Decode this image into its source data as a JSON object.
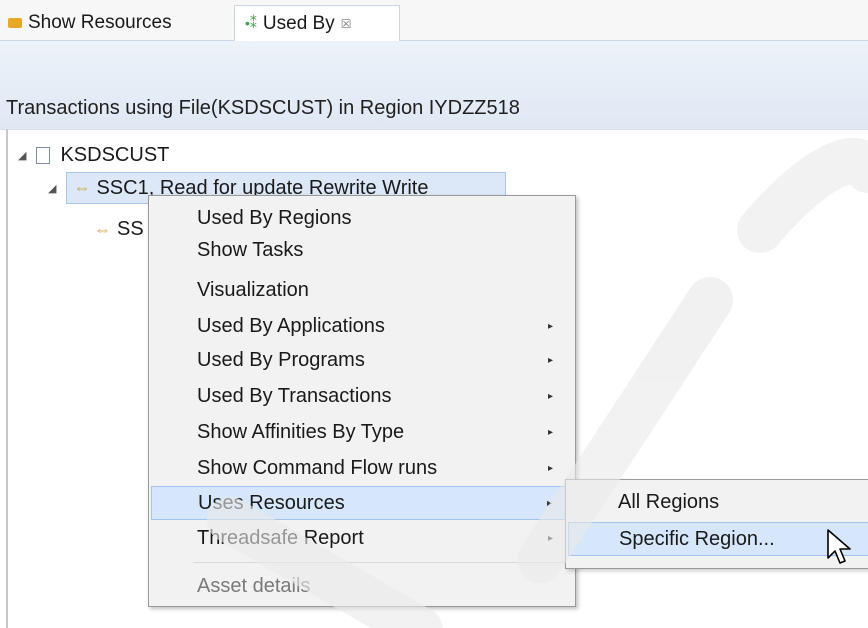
{
  "tabs": [
    {
      "label": "Show Resources",
      "icon": "resource-icon"
    },
    {
      "label": "Used By",
      "icon": "used-by-icon",
      "close": "☒"
    }
  ],
  "view": {
    "title": "Transactions using File(KSDSCUST) in Region IYDZZ518"
  },
  "tree": {
    "root": "KSDSCUST",
    "child": "SSC1, Read for update Rewrite Write",
    "grandchild": "SS"
  },
  "context_menu": {
    "items": [
      {
        "label": "Used By Regions",
        "submenu": false
      },
      {
        "label": "Show Tasks",
        "submenu": false
      },
      {
        "label": "Visualization",
        "submenu": false
      },
      {
        "label": "Used By Applications",
        "submenu": true
      },
      {
        "label": "Used By Programs",
        "submenu": true
      },
      {
        "label": "Used By Transactions",
        "submenu": true
      },
      {
        "label": "Show Affinities By Type",
        "submenu": true
      },
      {
        "label": "Show Command Flow runs",
        "submenu": true
      },
      {
        "label": "Uses Resources",
        "submenu": true,
        "highlighted": true
      },
      {
        "label": "Threadsafe Report",
        "submenu": true
      },
      {
        "label": "Asset details",
        "submenu": false,
        "disabled": true
      }
    ]
  },
  "submenu": {
    "items": [
      {
        "label": "All Regions"
      },
      {
        "label": "Specific Region...",
        "highlighted": true
      }
    ]
  },
  "colors": {
    "selection": "#d6e7fb",
    "selection_border": "#9fc3ee",
    "menu_bg": "#f2f2f2",
    "header_band": "#e4ecf7"
  }
}
